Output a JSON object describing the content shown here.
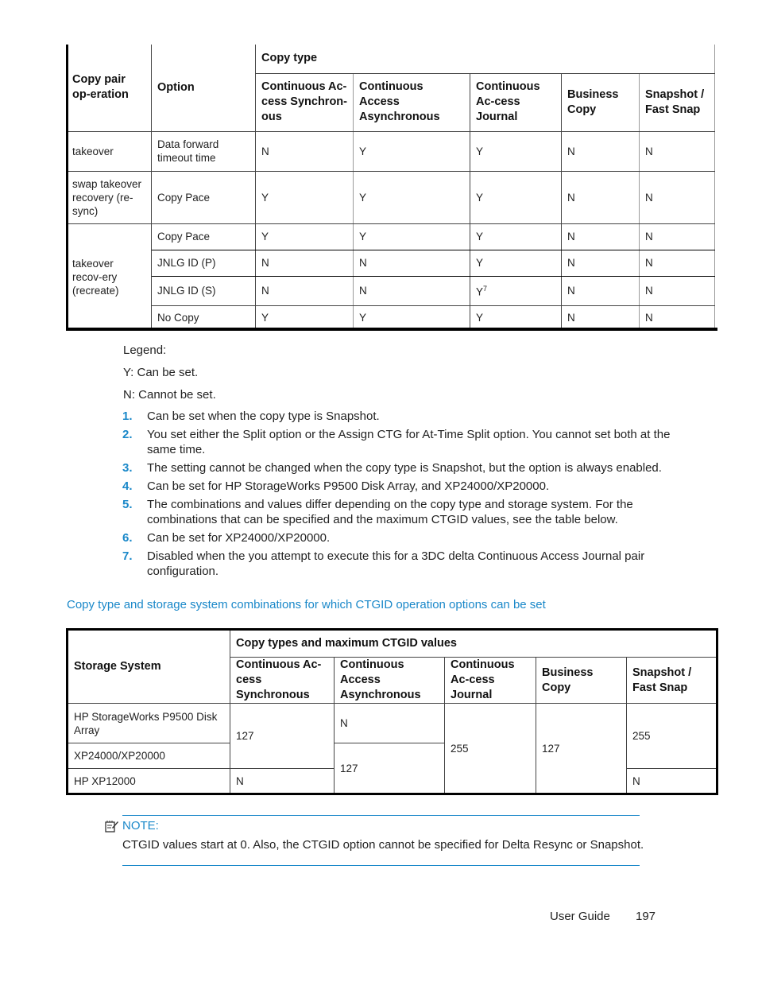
{
  "table1": {
    "headers": {
      "copy_pair_operation": "Copy pair op-eration",
      "option": "Option",
      "copy_type": "Copy type",
      "columns": [
        "Continuous Ac-cess Synchron-ous",
        "Continuous Access Asynchronous",
        "Continuous Ac-cess Journal",
        "Business Copy",
        "Snapshot / Fast Snap"
      ]
    },
    "groups": [
      {
        "operation": "takeover",
        "rows": [
          {
            "option": "Data forward timeout time",
            "values": [
              "N",
              "Y",
              "Y",
              "N",
              "N"
            ]
          }
        ]
      },
      {
        "operation": "swap takeover recovery (re-sync)",
        "rows": [
          {
            "option": "Copy Pace",
            "values": [
              "Y",
              "Y",
              "Y",
              "N",
              "N"
            ]
          }
        ]
      },
      {
        "operation": "takeover recov-ery (recreate)",
        "rows": [
          {
            "option": "Copy Pace",
            "values": [
              "Y",
              "Y",
              "Y",
              "N",
              "N"
            ]
          },
          {
            "option": "JNLG ID (P)",
            "values": [
              "N",
              "N",
              "Y",
              "N",
              "N"
            ]
          },
          {
            "option": "JNLG ID (S)",
            "values": [
              "N",
              "N",
              "Y",
              "N",
              "N"
            ],
            "footnote_col": 2,
            "footnote": "7"
          },
          {
            "option": "No Copy",
            "values": [
              "Y",
              "Y",
              "Y",
              "N",
              "N"
            ]
          }
        ]
      }
    ]
  },
  "legend": {
    "title": "Legend:",
    "y": "Y: Can be set.",
    "n": "N: Cannot be set."
  },
  "footnotes": [
    {
      "num": "1.",
      "text": "Can be set when the copy type is Snapshot."
    },
    {
      "num": "2.",
      "text": "You set either the Split option or the Assign CTG for At-Time Split option. You cannot set both at the same time."
    },
    {
      "num": "3.",
      "text": "The setting cannot be changed when the copy type is Snapshot, but the option is always enabled."
    },
    {
      "num": "4.",
      "text": "Can be set for HP StorageWorks P9500 Disk Array, and XP24000/XP20000."
    },
    {
      "num": "5.",
      "text": "The combinations and values differ depending on the copy type and storage system. For the combinations that can be specified and the maximum CTGID values, see the table below."
    },
    {
      "num": "6.",
      "text": "Can be set for XP24000/XP20000."
    },
    {
      "num": "7.",
      "text": "Disabled when the you attempt to execute this for a 3DC delta Continuous Access Journal pair configuration."
    }
  ],
  "section_heading": "Copy type and storage system combinations for which CTGID operation options can be set",
  "table2": {
    "headers": {
      "storage_system": "Storage System",
      "group": "Copy types and maximum CTGID values",
      "columns": [
        "Continuous Ac-cess Synchronous",
        "Continuous Access Asynchronous",
        "Continuous Ac-cess Journal",
        "Business Copy",
        "Snapshot / Fast Snap"
      ]
    },
    "rows": [
      {
        "system": "HP StorageWorks P9500 Disk Array"
      },
      {
        "system": "XP24000/XP20000"
      },
      {
        "system": "HP XP12000"
      }
    ],
    "cells": {
      "sync_p9500_xp24000": "127",
      "sync_xp12000": "N",
      "async_p9500": "N",
      "async_xp24000_xp12000": "127",
      "journal_all": "255",
      "business_copy_all": "127",
      "snapshot_p9500_xp24000": "255",
      "snapshot_xp12000": "N"
    }
  },
  "note": {
    "icon": "note-pencil-icon",
    "label": "NOTE:",
    "text": "CTGID values start at 0. Also, the CTGID option cannot be specified for Delta Resync or Snapshot."
  },
  "footer": {
    "title": "User Guide",
    "page": "197"
  },
  "colors": {
    "accent": "#1a88c9",
    "text": "#222222",
    "border": "#000000"
  }
}
